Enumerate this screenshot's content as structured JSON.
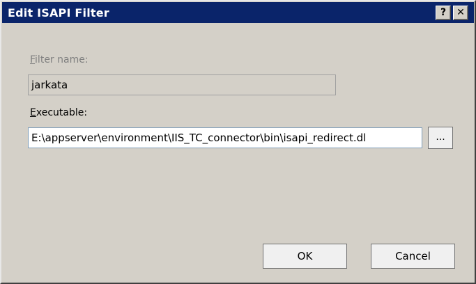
{
  "window": {
    "title": "Edit ISAPI Filter",
    "help_glyph": "?",
    "close_glyph": "✕"
  },
  "filter_name": {
    "label_mnemonic": "F",
    "label_rest": "ilter name:",
    "value": "jarkata"
  },
  "executable": {
    "label_mnemonic": "E",
    "label_rest": "xecutable:",
    "value": "E:\\appserver\\environment\\IIS_TC_connector\\bin\\isapi_redirect.dl",
    "browse_label": "..."
  },
  "buttons": {
    "ok": "OK",
    "cancel": "Cancel"
  }
}
